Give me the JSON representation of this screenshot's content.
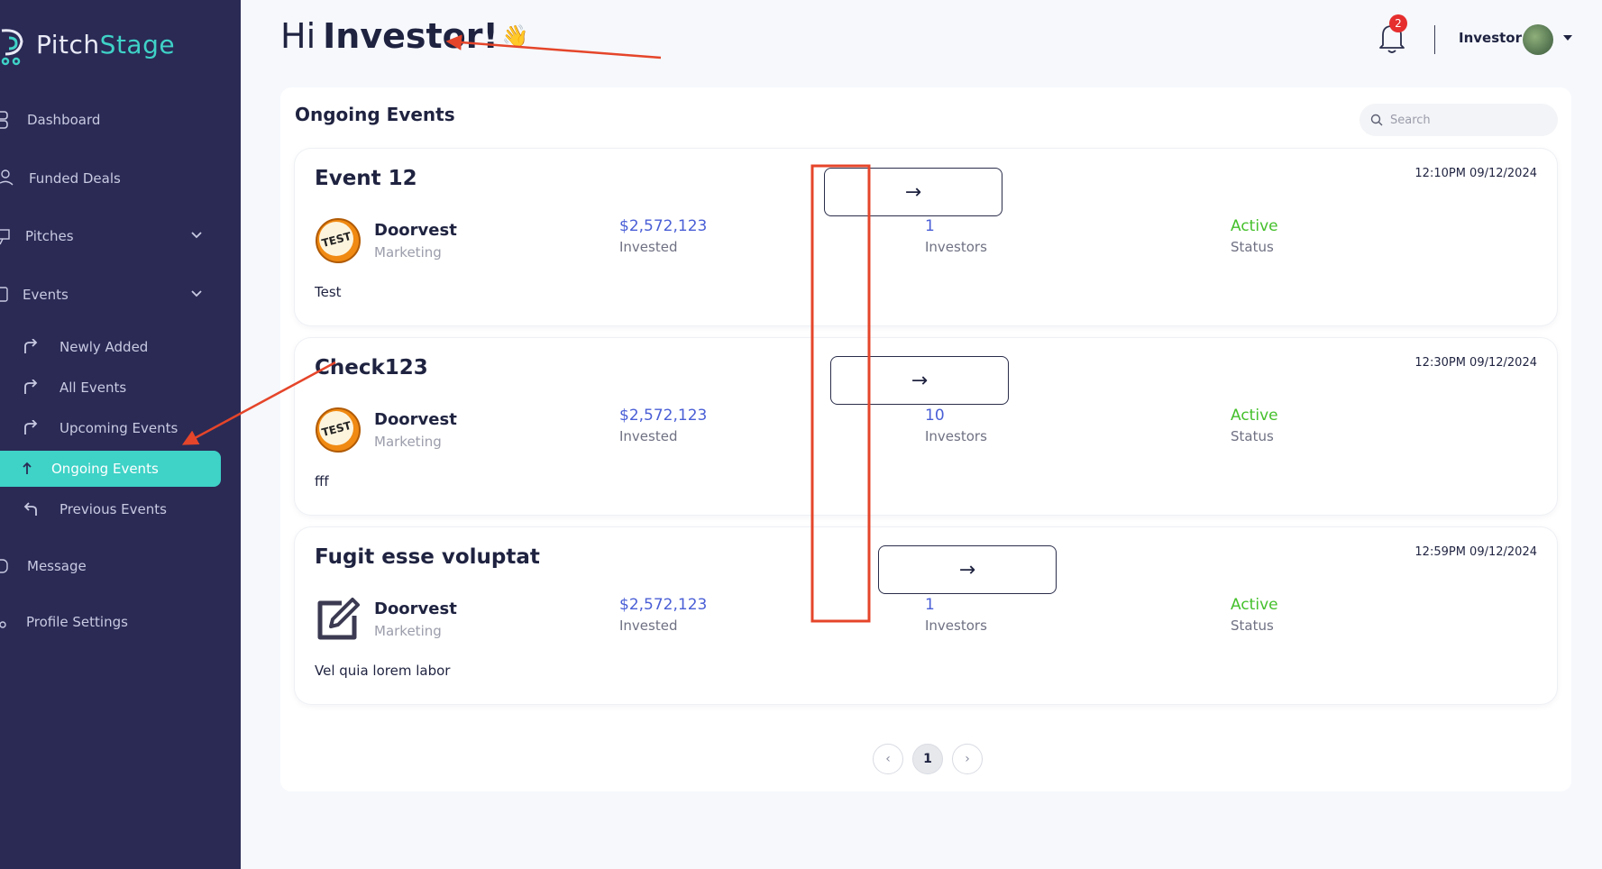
{
  "app": {
    "logo_pitch": "Pitch",
    "logo_stage": "Stage"
  },
  "sidebar": {
    "items": [
      {
        "label": "Dashboard",
        "icon": "grid-icon"
      },
      {
        "label": "Funded Deals",
        "icon": "hand-coin-icon"
      },
      {
        "label": "Pitches",
        "icon": "presentation-icon"
      },
      {
        "label": "Events",
        "icon": "calendar-icon"
      },
      {
        "label": "Message",
        "icon": "message-icon"
      },
      {
        "label": "Profile Settings",
        "icon": "gear-icon"
      }
    ],
    "sub_items": [
      {
        "label": "Newly Added"
      },
      {
        "label": "All Events"
      },
      {
        "label": "Upcoming Events"
      },
      {
        "label": "Ongoing Events"
      },
      {
        "label": "Previous Events"
      }
    ]
  },
  "header": {
    "hi": "Hi",
    "name": "Investor!",
    "wave": "👋",
    "notification_count": "2",
    "user_name": "Investor"
  },
  "main": {
    "title": "Ongoing Events",
    "search_placeholder": "Search",
    "events": [
      {
        "title": "Event 12",
        "time": "12:10PM 09/12/2024",
        "company": "Doorvest",
        "category": "Marketing",
        "invested_value": "$2,572,123",
        "invested_label": "Invested",
        "investors_value": "1",
        "investors_label": "Investors",
        "status_value": "Active",
        "status_label": "Status",
        "description": "Test",
        "logo": "test-badge",
        "arrow": "→"
      },
      {
        "title": "Check123",
        "time": "12:30PM 09/12/2024",
        "company": "Doorvest",
        "category": "Marketing",
        "invested_value": "$2,572,123",
        "invested_label": "Invested",
        "investors_value": "10",
        "investors_label": "Investors",
        "status_value": "Active",
        "status_label": "Status",
        "description": "fff",
        "logo": "test-badge",
        "arrow": "→"
      },
      {
        "title": "Fugit esse voluptat",
        "time": "12:59PM 09/12/2024",
        "company": "Doorvest",
        "category": "Marketing",
        "invested_value": "$2,572,123",
        "invested_label": "Invested",
        "investors_value": "1",
        "investors_label": "Investors",
        "status_value": "Active",
        "status_label": "Status",
        "description": "Vel quia lorem labor",
        "logo": "edit-icon",
        "arrow": "→"
      }
    ],
    "pagination": {
      "prev": "‹",
      "current": "1",
      "next": "›"
    }
  },
  "colors": {
    "sidebar_bg": "#2a2a55",
    "accent": "#3fd2c7",
    "invested_blue": "#4a5fd6",
    "status_green": "#45c02c",
    "annotation_red": "#e5452a"
  }
}
